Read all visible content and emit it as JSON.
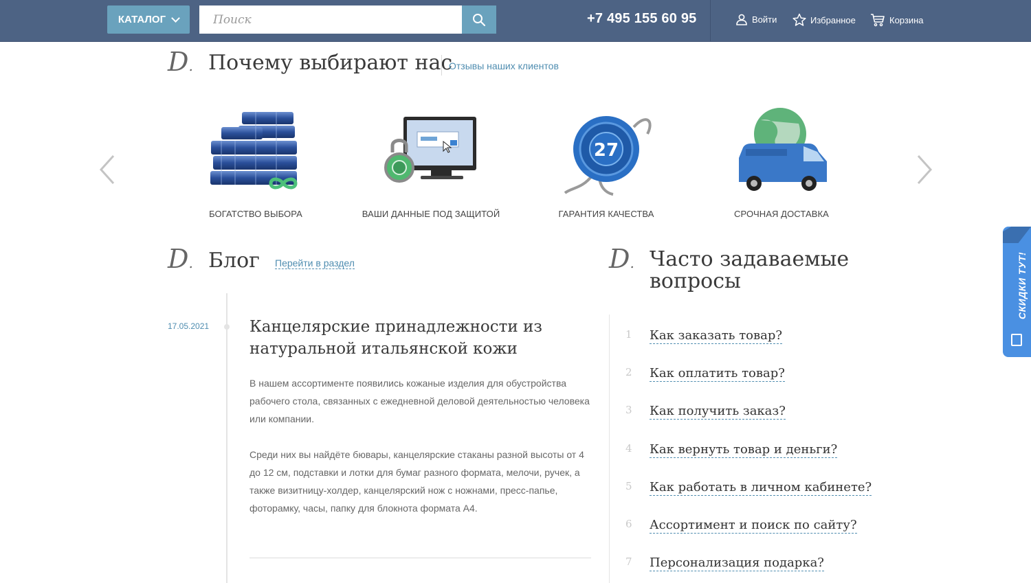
{
  "header": {
    "catalog_label": "КАТАЛОГ",
    "search_placeholder": "Поиск",
    "phone": "+7 495 155 60 95",
    "login_label": "Войти",
    "favorites_label": "Избранное",
    "cart_label": "Корзина"
  },
  "why": {
    "logo": "D",
    "title": "Почему выбирают нас",
    "reviews_link": "Отзывы наших клиентов",
    "features": [
      {
        "label": "БОГАТСТВО ВЫБОРА",
        "icon": "books-icon"
      },
      {
        "label": "ВАШИ ДАННЫЕ ПОД ЗАЩИТОЙ",
        "icon": "secure-monitor-icon"
      },
      {
        "label": "ГАРАНТИЯ КАЧЕСТВА",
        "icon": "quality-seal-icon",
        "seal_number": "27"
      },
      {
        "label": "СРОЧНАЯ ДОСТАВКА",
        "icon": "delivery-van-icon"
      }
    ]
  },
  "blog": {
    "logo": "D",
    "title": "Блог",
    "section_link": "Перейти в раздел",
    "post": {
      "date": "17.05.2021",
      "title": "Канцелярские принадлежности из натуральной итальянской кожи",
      "para1": "В нашем ассортименте появились кожаные изделия для обустройства рабочего стола, связанных с ежедневной деловой деятельностью человека или компании.",
      "para2": "Среди них вы найдёте бювары, канцелярские стаканы разной высоты от 4 до 12 см, подставки и лотки для бумаг разного формата, мелочи, ручек, а также визитницу-холдер, канцелярский нож с ножнами, пресс-папье, фоторамку, часы, папку для блокнота формата А4."
    }
  },
  "faq": {
    "logo": "D",
    "title_line1": "Часто задаваемые",
    "title_line2": "вопросы",
    "items": [
      {
        "num": "1",
        "q": "Как заказать товар?"
      },
      {
        "num": "2",
        "q": "Как оплатить товар?"
      },
      {
        "num": "3",
        "q": "Как получить заказ?"
      },
      {
        "num": "4",
        "q": "Как вернуть товар и деньги?"
      },
      {
        "num": "5",
        "q": "Как работать в личном кабинете?"
      },
      {
        "num": "6",
        "q": "Ассортимент и поиск по сайту?"
      },
      {
        "num": "7",
        "q": "Персонализация подарка?"
      }
    ]
  },
  "discount_tab": {
    "label": "СКИДКИ ТУТ!"
  },
  "colors": {
    "header_bg": "#4d6384",
    "accent": "#6aa2bd",
    "link": "#4f8db0",
    "discount": "#4a90e2"
  }
}
